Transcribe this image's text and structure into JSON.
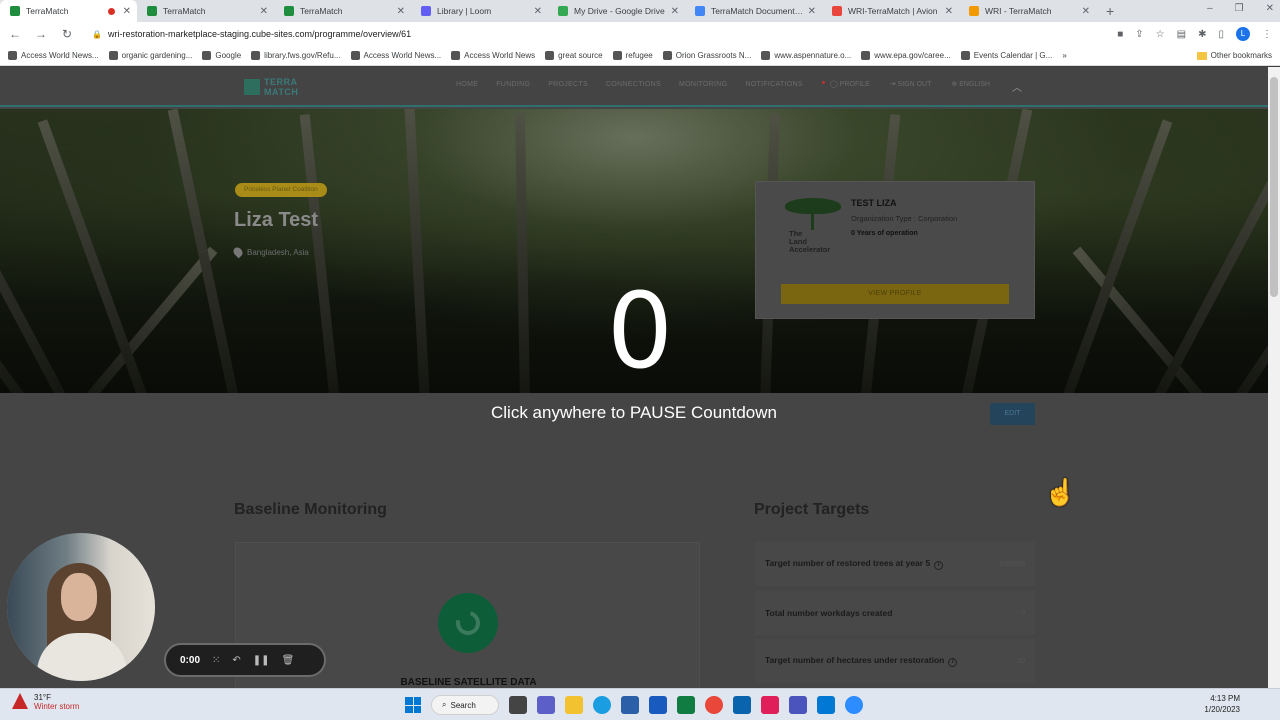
{
  "browser": {
    "tabs": [
      {
        "label": "TerraMatch",
        "color": "#1e8e3e"
      },
      {
        "label": "TerraMatch",
        "color": "#1e8e3e"
      },
      {
        "label": "TerraMatch",
        "color": "#1e8e3e"
      },
      {
        "label": "Library | Loom",
        "color": "#625df5"
      },
      {
        "label": "My Drive - Google Drive",
        "color": "#34a853"
      },
      {
        "label": "TerraMatch Documents - ",
        "color": "#4285f4"
      },
      {
        "label": "WRI-TerraMatch | Avion",
        "color": "#e8453c"
      },
      {
        "label": "WRI - TerraMatch",
        "color": "#f29900"
      }
    ],
    "url": "wri-restoration-marketplace-staging.cube-sites.com/programme/overview/61",
    "profile_initial": "L",
    "bookmarks": [
      "Access World News...",
      "organic gardening...",
      "Google",
      "library.fws.gov/Refu...",
      "Access World News...",
      "Access World News",
      "great source",
      "refugee",
      "Orion Grassroots N...",
      "www.aspennature.o...",
      "www.epa.gov/caree...",
      "Events Calendar | G..."
    ],
    "other_bookmarks": "Other bookmarks"
  },
  "site": {
    "logo_line1": "TERRA",
    "logo_line2": "MATCH",
    "nav": [
      "HOME",
      "FUNDING",
      "PROJECTS",
      "CONNECTIONS",
      "MONITORING",
      "NOTIFICATIONS"
    ],
    "profile": "PROFILE",
    "sign_out": "SIGN OUT",
    "language": "ENGLISH",
    "badge": "Priceless Planet Coalition",
    "project_title": "Liza Test",
    "location": "Bangladesh, Asia",
    "org": {
      "name": "TEST LIZA",
      "type": "Organization Type : Corporation",
      "years": "0 Years of operation",
      "logo_text_1": "The",
      "logo_text_2": "Land",
      "logo_text_3": "Accelerator",
      "view_profile": "VIEW PROFILE"
    },
    "edit": "EDIT",
    "baseline_title": "Baseline Monitoring",
    "baseline_card": "BASELINE SATELLITE DATA",
    "targets_title": "Project Targets",
    "targets": [
      {
        "label": "Target number of restored trees at year 5",
        "value": "0/99999",
        "info": true
      },
      {
        "label": "Total number workdays created",
        "value": "0",
        "info": false
      },
      {
        "label": "Target number of hectares under restoration",
        "value": "20",
        "info": true
      }
    ]
  },
  "loom": {
    "countdown": "0",
    "pause_message": "Click anywhere to PAUSE Countdown",
    "timer": "0:00"
  },
  "taskbar": {
    "temp": "31°F",
    "weather": "Winter storm",
    "search": "Search",
    "time": "4:13 PM",
    "date": "1/20/2023"
  }
}
